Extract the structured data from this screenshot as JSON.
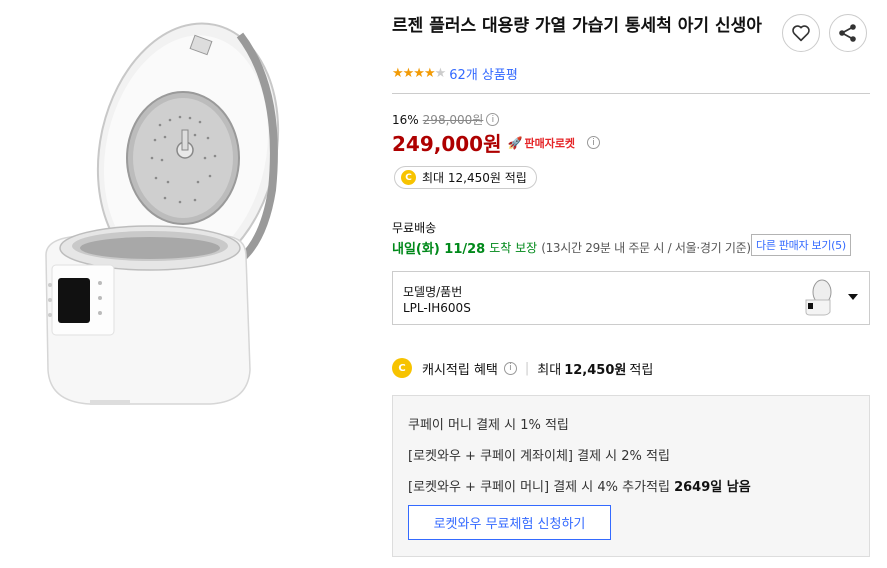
{
  "product": {
    "title": "르젠 플러스 대용량 가열 가습기 통세척 아기 신생아",
    "rating_stars": 4,
    "rating_max": 5,
    "review_count": "62개 상품평"
  },
  "pricing": {
    "discount": "16%",
    "original_price": "298,000원",
    "sale_price": "249,000원",
    "badge": "판매자로켓",
    "reward": "최대 12,450원 적립"
  },
  "shipping": {
    "label": "무료배송",
    "arrival_date": "내일(화) 11/28",
    "arrival_suffix": "도착 보장",
    "cutoff": "(13시간 29분  내 주문 시 / 서울·경기 기준)",
    "other_sellers": "다른 판매자 보기(5)"
  },
  "option": {
    "label": "모델명/품번",
    "value": "LPL-IH600S"
  },
  "cash": {
    "label": "캐시적립 혜택",
    "prefix": "최대",
    "amount": "12,450원",
    "suffix": "적립"
  },
  "benefits": {
    "lines": [
      "쿠페이 머니 결제 시 1% 적립",
      "[로켓와우 + 쿠페이 계좌이체] 결제 시 2% 적립",
      "[로켓와우 + 쿠페이 머니] 결제 시 4% 추가적립"
    ],
    "days_left": "2649일 남음",
    "trial_button": "로켓와우 무료체험 신청하기"
  },
  "icons": {
    "wishlist": "heart-icon",
    "share": "share-icon",
    "rocket": "rocket-icon",
    "coin": "coin-icon"
  },
  "colors": {
    "sale_price": "#ae0000",
    "accent_blue": "#346aff",
    "arrival_green": "#00891a",
    "star": "#f29b06",
    "coin": "#f7c300"
  }
}
